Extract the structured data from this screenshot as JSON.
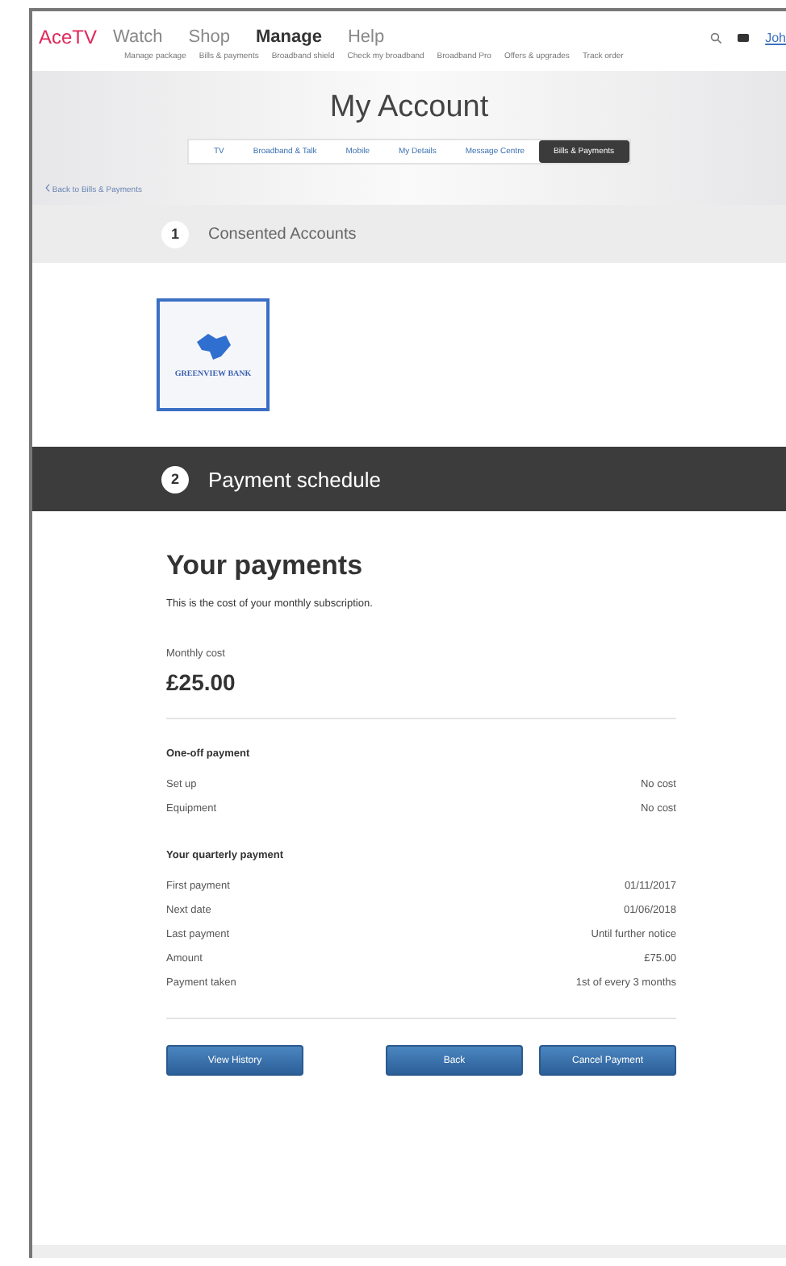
{
  "header": {
    "logo": "AceTV",
    "nav": [
      {
        "label": "Watch",
        "selected": false
      },
      {
        "label": "Shop",
        "selected": false
      },
      {
        "label": "Manage",
        "selected": true
      },
      {
        "label": "Help",
        "selected": false
      }
    ],
    "account": "Joh",
    "subnav": [
      "Manage package",
      "Bills & payments",
      "Broadband shield",
      "Check my broadband",
      "Broadband Pro",
      "Offers & upgrades",
      "Track order"
    ]
  },
  "title": "My Account",
  "tabs": [
    {
      "label": "TV",
      "selected": false
    },
    {
      "label": "Broadband & Talk",
      "selected": false
    },
    {
      "label": "Mobile",
      "selected": false
    },
    {
      "label": "My Details",
      "selected": false
    },
    {
      "label": "Message Centre",
      "selected": false
    },
    {
      "label": "Bills & Payments",
      "selected": true
    }
  ],
  "back_link": "Back to Bills & Payments",
  "steps": [
    {
      "number": "1",
      "title": "Consented Accounts",
      "selected": false
    },
    {
      "number": "2",
      "title": "Payment schedule",
      "selected": true
    }
  ],
  "bank": {
    "name": "GREENVIEW BANK",
    "selected": true
  },
  "payments": {
    "heading": "Your payments",
    "intro": "This is the cost of your monthly subscription.",
    "cost_label": "Monthly cost",
    "cost": "£25.00",
    "sections": [
      {
        "heading": "One-off payment",
        "rows": [
          {
            "label": "Set up",
            "value": "No cost"
          },
          {
            "label": "Equipment",
            "value": "No cost"
          }
        ]
      },
      {
        "heading": "Your quarterly payment",
        "rows": [
          {
            "label": "First payment",
            "value": "01/11/2017"
          },
          {
            "label": "Next date",
            "value": "01/06/2018"
          },
          {
            "label": "Last payment",
            "value": "Until further notice"
          },
          {
            "label": "Amount",
            "value": "£75.00"
          },
          {
            "label": "Payment taken",
            "value": "1st of every 3 months"
          }
        ]
      }
    ],
    "buttons": [
      "View History",
      "Back",
      "Cancel Payment"
    ]
  }
}
